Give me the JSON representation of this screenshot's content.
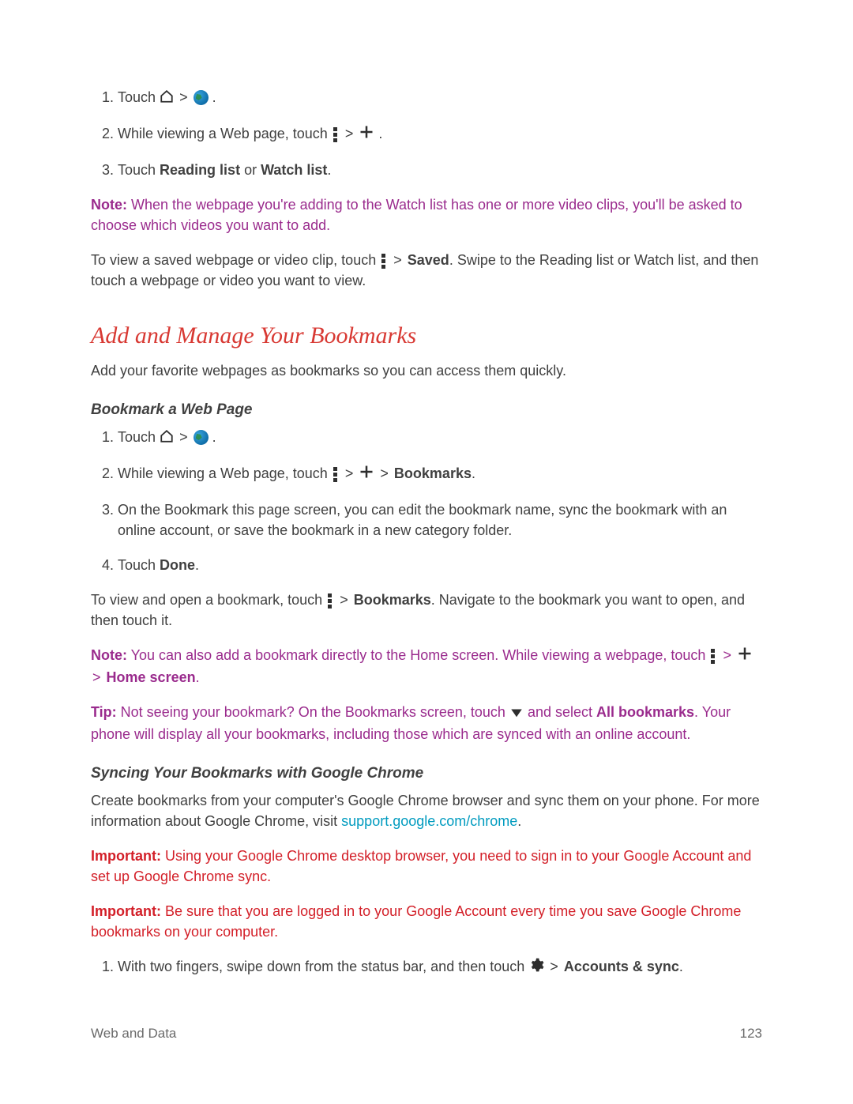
{
  "steps_a": {
    "one_pre": "Touch ",
    "one_post": ".",
    "two_pre": "While viewing a Web page, touch ",
    "two_post": ".",
    "three_pre": "Touch ",
    "three_b1": "Reading list",
    "three_mid": " or ",
    "three_b2": "Watch list",
    "three_post": "."
  },
  "note1": {
    "label": "Note:",
    "body": " When the webpage you're adding to the Watch list has one or more video clips, you'll be asked to choose which videos you want to add."
  },
  "saved_para": {
    "pre": "To view a saved webpage or video clip, touch ",
    "bold": "Saved",
    "post": ". Swipe to the Reading list or Watch list, and then touch a webpage or video you want to view."
  },
  "section_title": "Add and Manage Your Bookmarks",
  "intro": "Add your favorite webpages as bookmarks so you can access them quickly.",
  "sub1": "Bookmark a Web Page",
  "steps_b": {
    "one_pre": "Touch ",
    "one_post": ".",
    "two_pre": "While viewing a Web page, touch ",
    "two_bold": "Bookmarks",
    "two_post": ".",
    "three": "On the Bookmark this page screen, you can edit the bookmark name, sync the bookmark with an online account, or save the bookmark in a new category folder.",
    "four_pre": "Touch ",
    "four_bold": "Done",
    "four_post": "."
  },
  "view_bookmark": {
    "pre": "To view and open a bookmark, touch ",
    "bold": "Bookmarks",
    "post": ". Navigate to the bookmark you want to open, and then touch it."
  },
  "note2": {
    "label": "Note:",
    "body_pre": " You can also add a bookmark directly to the Home screen. While viewing a webpage, touch ",
    "home_bold": "Home screen",
    "post": "."
  },
  "tip": {
    "label": "Tip:",
    "body_pre": " Not seeing your bookmark? On the Bookmarks screen, touch ",
    "body_mid": " and select ",
    "bold": "All bookmarks",
    "body_post": ". Your phone will display all your bookmarks, including those which are synced with an online account."
  },
  "sub2": "Syncing Your Bookmarks with Google Chrome",
  "sync_para": {
    "pre": "Create bookmarks from your computer's Google Chrome browser and sync them on your phone. For more information about Google Chrome, visit ",
    "link": "support.google.com/chrome",
    "post": "."
  },
  "important1": {
    "label": "Important:",
    "body": " Using your Google Chrome desktop browser, you need to sign in to your Google Account and set up Google Chrome sync."
  },
  "important2": {
    "label": "Important:",
    "body": " Be sure that you are logged in to your Google Account every time you save Google Chrome bookmarks on your computer."
  },
  "steps_c": {
    "one_pre": "With two fingers, swipe down from the status bar, and then touch ",
    "one_bold": "Accounts & sync",
    "one_post": "."
  },
  "footer": {
    "left": "Web and Data",
    "right": "123"
  },
  "gt": ">"
}
